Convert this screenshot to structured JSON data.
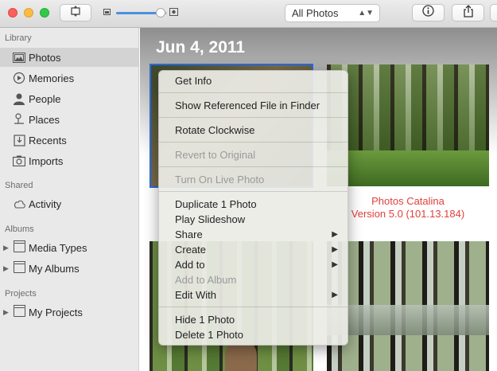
{
  "toolbar": {
    "window_buttons": [
      "close",
      "minimize",
      "zoom"
    ],
    "view_toggle_icon": "rotate-view-icon",
    "zoom_small_icon": "small-photo-icon",
    "zoom_large_icon": "large-photo-icon",
    "zoom_level": 0.88,
    "filter_select": "All Photos",
    "info_icon": "info-icon",
    "share_icon": "share-icon"
  },
  "sidebar": {
    "library_label": "Library",
    "library_items": [
      {
        "label": "Photos",
        "icon": "photos-icon",
        "selected": true
      },
      {
        "label": "Memories",
        "icon": "memories-icon"
      },
      {
        "label": "People",
        "icon": "people-icon"
      },
      {
        "label": "Places",
        "icon": "places-pin-icon"
      },
      {
        "label": "Recents",
        "icon": "recents-icon"
      },
      {
        "label": "Imports",
        "icon": "imports-camera-icon"
      }
    ],
    "shared_label": "Shared",
    "shared_items": [
      {
        "label": "Activity",
        "icon": "cloud-icon"
      }
    ],
    "albums_label": "Albums",
    "album_items": [
      {
        "label": "Media Types",
        "icon": "folder-icon"
      },
      {
        "label": "My Albums",
        "icon": "folder-icon"
      }
    ],
    "projects_label": "Projects",
    "project_items": [
      {
        "label": "My Projects",
        "icon": "folder-icon"
      }
    ]
  },
  "main": {
    "date_heading": "Jun 4, 2011",
    "overlay_line1": "Photos Catalina",
    "overlay_line2": "Version 5.0 (101.13.184)"
  },
  "context_menu": {
    "items": [
      {
        "label": "Get Info",
        "enabled": true
      },
      {
        "label": "Show Referenced File in Finder",
        "enabled": true
      },
      {
        "label": "Rotate Clockwise",
        "enabled": true
      },
      {
        "label": "Revert to Original",
        "enabled": false
      },
      {
        "label": "Turn On Live Photo",
        "enabled": false
      },
      {
        "label": "Duplicate 1 Photo",
        "enabled": true
      },
      {
        "label": "Play Slideshow",
        "enabled": true
      },
      {
        "label": "Share",
        "enabled": true,
        "submenu": true
      },
      {
        "label": "Create",
        "enabled": true,
        "submenu": true
      },
      {
        "label": "Add to",
        "enabled": true,
        "submenu": true
      },
      {
        "label": "Add to Album",
        "enabled": false
      },
      {
        "label": "Edit With",
        "enabled": true,
        "submenu": true
      },
      {
        "label": "Hide 1 Photo",
        "enabled": true
      },
      {
        "label": "Delete 1 Photo",
        "enabled": true
      }
    ]
  },
  "colors": {
    "accent": "#2a6be0",
    "overlay_text": "#e0403b",
    "sidebar_bg": "#e9e9e9"
  }
}
